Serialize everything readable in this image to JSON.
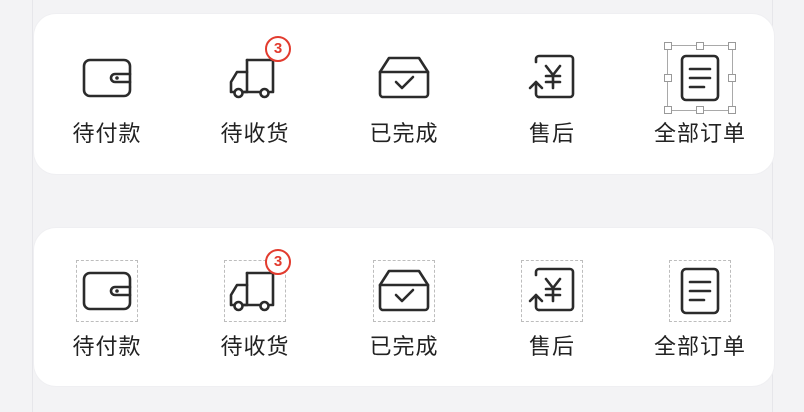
{
  "order_panels": [
    {
      "items": [
        {
          "id": "pending-payment",
          "label": "待付款",
          "icon": "wallet-icon"
        },
        {
          "id": "pending-receipt",
          "label": "待收货",
          "icon": "truck-icon",
          "badge": "3"
        },
        {
          "id": "completed",
          "label": "已完成",
          "icon": "box-check-icon"
        },
        {
          "id": "after-sales",
          "label": "售后",
          "icon": "yen-return-icon"
        },
        {
          "id": "all-orders",
          "label": "全部订单",
          "icon": "document-list-icon"
        }
      ]
    },
    {
      "items": [
        {
          "id": "pending-payment",
          "label": "待付款",
          "icon": "wallet-icon"
        },
        {
          "id": "pending-receipt",
          "label": "待收货",
          "icon": "truck-icon",
          "badge": "3"
        },
        {
          "id": "completed",
          "label": "已完成",
          "icon": "box-check-icon"
        },
        {
          "id": "after-sales",
          "label": "售后",
          "icon": "yen-return-icon"
        },
        {
          "id": "all-orders",
          "label": "全部订单",
          "icon": "document-list-icon"
        }
      ]
    }
  ],
  "colors": {
    "badge": "#e23b2e",
    "icon_stroke": "#2b2b2b",
    "card_bg": "#ffffff",
    "page_bg": "#f3f3f5"
  }
}
